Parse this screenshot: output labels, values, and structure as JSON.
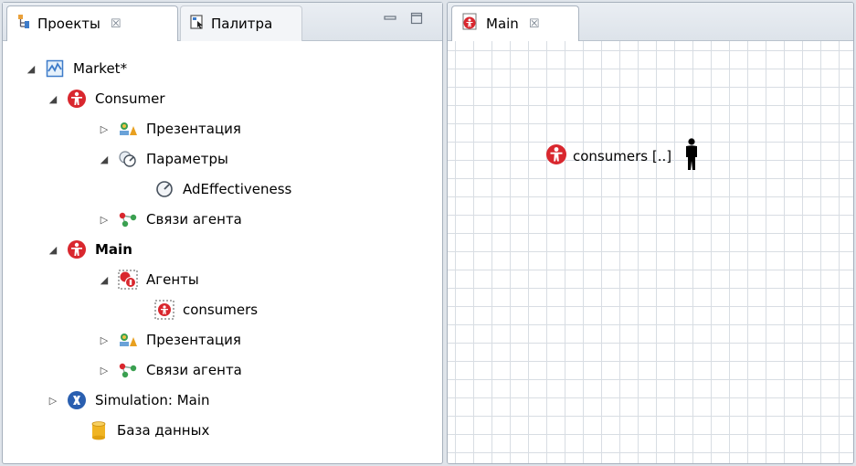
{
  "left_panel": {
    "tabs": [
      {
        "label": "Проекты",
        "close": "☒",
        "icon": "projects-icon",
        "active": true
      },
      {
        "label": "Палитра",
        "icon": "palette-icon",
        "active": false
      }
    ],
    "controls": {
      "minimize_icon": "minimize-icon",
      "maximize_icon": "maximize-icon"
    }
  },
  "tree": {
    "items": [
      {
        "label": "Market*",
        "icon": "model-icon",
        "expanded": true
      },
      {
        "label": "Consumer",
        "icon": "agent-type-icon",
        "expanded": true
      },
      {
        "label": "Презентация",
        "icon": "presentation-icon",
        "expanded": false
      },
      {
        "label": "Параметры",
        "icon": "parameters-icon",
        "expanded": true
      },
      {
        "label": "AdEffectiveness",
        "icon": "parameter-icon"
      },
      {
        "label": "Связи агента",
        "icon": "agent-links-icon",
        "expanded": false
      },
      {
        "label": "Main",
        "icon": "agent-type-icon",
        "expanded": true,
        "bold": true
      },
      {
        "label": "Агенты",
        "icon": "agents-icon",
        "expanded": true
      },
      {
        "label": "consumers",
        "icon": "agent-population-icon"
      },
      {
        "label": "Презентация",
        "icon": "presentation-icon",
        "expanded": false
      },
      {
        "label": "Связи агента",
        "icon": "agent-links-icon",
        "expanded": false
      },
      {
        "label": "Simulation: Main",
        "icon": "simulation-icon",
        "expanded": false
      },
      {
        "label": "База данных",
        "icon": "database-icon"
      }
    ]
  },
  "editor": {
    "tab": {
      "label": "Main",
      "close": "☒",
      "icon": "agent-type-icon"
    },
    "canvas_item": {
      "label": "consumers [..]",
      "icon": "agent-type-icon",
      "figure_icon": "person-figure-icon"
    }
  },
  "colors": {
    "agent_red": "#d9272e",
    "grid": "#d8dde3",
    "tab_bar": "#e3e8ee"
  }
}
